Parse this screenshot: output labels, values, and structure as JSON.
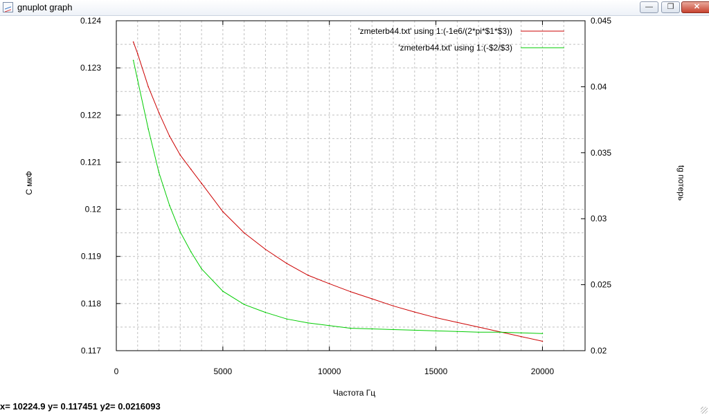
{
  "window": {
    "title": "gnuplot graph",
    "icon": "gnuplot-graph-icon",
    "controls": {
      "minimize": "—",
      "maximize": "❐",
      "close": "✕"
    }
  },
  "status_bar": {
    "text": "x= 10224.9 y= 0.117451 y2= 0.0216093"
  },
  "chart_data": {
    "type": "line",
    "xlabel": "Частота Гц",
    "ylabel": "C мкФ",
    "y2label": "tg потерь",
    "xlim": [
      0,
      22000
    ],
    "ylim": [
      0.117,
      0.124
    ],
    "y2lim": [
      0.02,
      0.045
    ],
    "x_ticks": [
      0,
      5000,
      10000,
      15000,
      20000
    ],
    "x_tick_labels": [
      "0",
      "5000",
      "10000",
      "15000",
      "20000"
    ],
    "y_ticks": [
      0.117,
      0.118,
      0.119,
      0.12,
      0.121,
      0.122,
      0.123,
      0.124
    ],
    "y_tick_labels": [
      "0.117",
      "0.118",
      "0.119",
      "0.12",
      "0.121",
      "0.122",
      "0.123",
      "0.124"
    ],
    "y2_ticks": [
      0.02,
      0.025,
      0.03,
      0.035,
      0.04,
      0.045
    ],
    "y2_tick_labels": [
      "0.02",
      "0.025",
      "0.03",
      "0.035",
      "0.04",
      "0.045"
    ],
    "grid": true,
    "legend_position": "top-right",
    "series": [
      {
        "name": "'zmeterb44.txt' using 1:(-1e6/(2*pi*$1*$3))",
        "axis": "y",
        "color": "#cc0000",
        "x": [
          800,
          1000,
          1500,
          2000,
          2500,
          3000,
          3500,
          4000,
          5000,
          6000,
          7000,
          8000,
          9000,
          10000,
          11000,
          12000,
          13000,
          14000,
          15000,
          16000,
          17000,
          18000,
          19000,
          20000
        ],
        "values": [
          0.12355,
          0.1233,
          0.1226,
          0.12205,
          0.12155,
          0.12115,
          0.12085,
          0.12055,
          0.11995,
          0.1195,
          0.11915,
          0.11885,
          0.1186,
          0.11842,
          0.11825,
          0.1181,
          0.11795,
          0.11782,
          0.1177,
          0.1176,
          0.1175,
          0.1174,
          0.1173,
          0.1172
        ]
      },
      {
        "name": "'zmeterb44.txt' using 1:(-$2/$3)",
        "axis": "y2",
        "color": "#00cc00",
        "x": [
          800,
          1000,
          1500,
          2000,
          2500,
          3000,
          3500,
          4000,
          5000,
          6000,
          7000,
          8000,
          9000,
          10000,
          11000,
          12000,
          13000,
          14000,
          15000,
          16000,
          17000,
          18000,
          19000,
          20000
        ],
        "values": [
          0.042,
          0.0405,
          0.0368,
          0.0335,
          0.031,
          0.029,
          0.0275,
          0.0262,
          0.0245,
          0.0235,
          0.0229,
          0.0224,
          0.0221,
          0.0219,
          0.0217,
          0.02165,
          0.0216,
          0.02155,
          0.0215,
          0.02145,
          0.0214,
          0.0214,
          0.02135,
          0.0213
        ]
      }
    ]
  }
}
